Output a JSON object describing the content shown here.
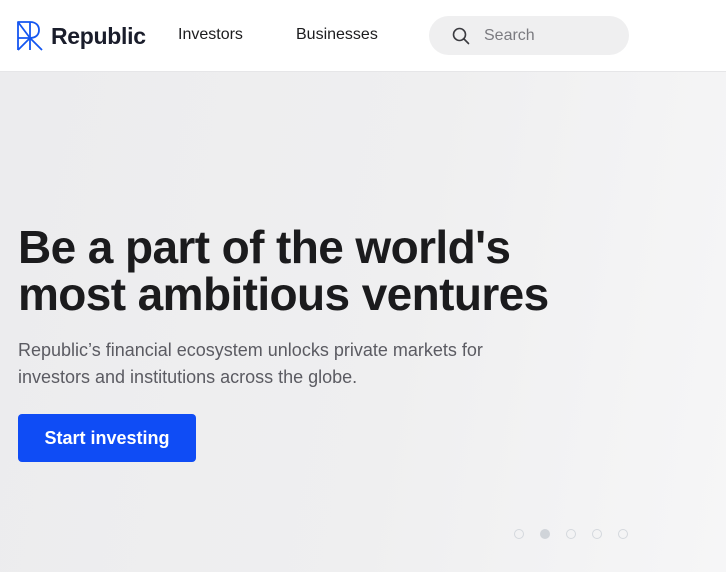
{
  "header": {
    "logo_text": "Republic",
    "nav": [
      {
        "label": "Investors"
      },
      {
        "label": "Businesses"
      }
    ],
    "search": {
      "placeholder": "Search",
      "value": ""
    }
  },
  "hero": {
    "title_line1": "Be a part of the world's",
    "title_line2": "most ambitious ventures",
    "subtitle_line1": "Republic’s financial ecosystem unlocks private markets for",
    "subtitle_line2": "investors and institutions across the globe.",
    "cta_label": "Start investing"
  },
  "carousel": {
    "count": 5,
    "active_index": 1
  },
  "colors": {
    "brand_blue": "#0f4cf5",
    "text_dark": "#1b1b1d",
    "background": "#f1f1f2"
  }
}
